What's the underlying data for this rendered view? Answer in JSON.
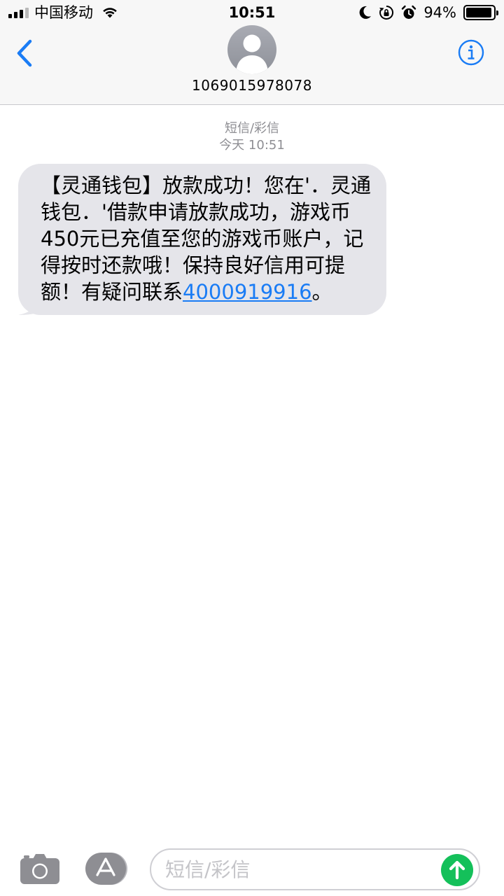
{
  "status_bar": {
    "carrier": "中国移动",
    "time": "10:51",
    "battery_percent_text": "94%",
    "battery_level": 0.94
  },
  "header": {
    "contact": "1069015978078",
    "back_icon": "chevron-left-icon",
    "info_icon": "info-circle-icon",
    "avatar_icon": "person-silhouette-icon"
  },
  "thread": {
    "service_label": "短信/彩信",
    "timestamp": "今天 10:51"
  },
  "message": {
    "text_before_link": "【灵通钱包】放款成功！您在'．灵通钱包．'借款申请放款成功，游戏币450元已充值至您的游戏币账户，记得按时还款哦！保持良好信用可提额！有疑问联系",
    "phone_link": "4000919916",
    "text_after_link": "。"
  },
  "input_bar": {
    "placeholder": "短信/彩信",
    "camera_icon": "camera-icon",
    "apps_icon": "app-store-icon",
    "send_icon": "arrow-up-icon"
  },
  "colors": {
    "accent": "#1a7cf5",
    "bubble": "#e5e5ea",
    "send": "#14c05a",
    "meta_text": "#8e8e93"
  }
}
